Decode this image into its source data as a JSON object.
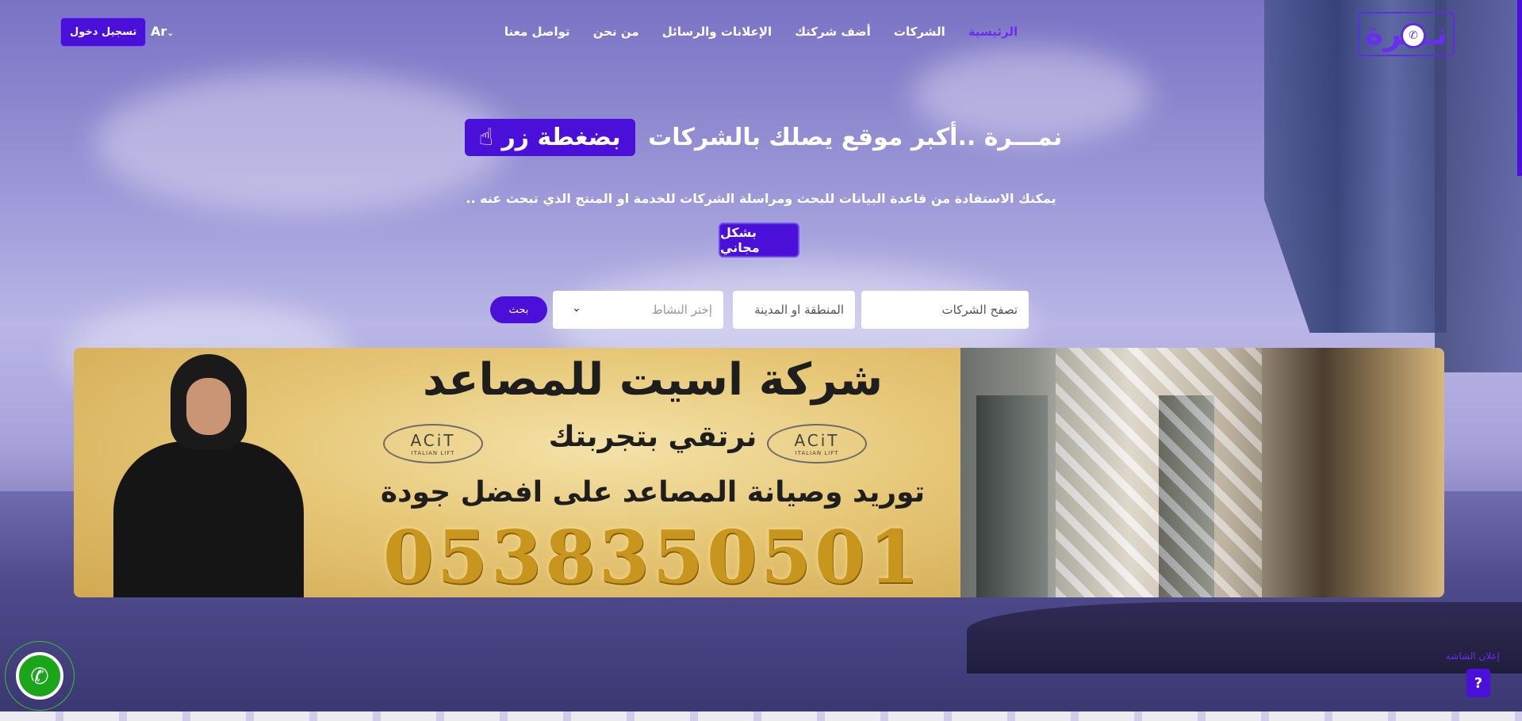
{
  "nav": {
    "logo_text": "نـــرة",
    "items": [
      {
        "label": "الرئيسية",
        "active": true
      },
      {
        "label": "الشركات",
        "active": false
      },
      {
        "label": "أضف شركتك",
        "active": false
      },
      {
        "label": "الإعلانات والرسائل",
        "active": false
      },
      {
        "label": "من نحن",
        "active": false
      },
      {
        "label": "تواصل معنا",
        "active": false
      }
    ],
    "lang": "Ar",
    "login_label": "تسجيل دخول"
  },
  "hero": {
    "title": "نمـــرة ..أكبر موقع يصلك بالشركات",
    "title_pill": "بضغطة زر",
    "subtitle": "يمكنك الاستفادة من قاعدة البيانات للبحث ومراسلة الشركات للخدمة او المنتج الذي تبحث عنه ..",
    "free_label": "بشكل مجاني"
  },
  "search": {
    "companies_placeholder": "تصفح الشركات",
    "region_placeholder": "المنطقة او المدينة",
    "activity_placeholder": "إختر النشاط",
    "button_label": "بحث"
  },
  "banner": {
    "title": "شركة اسيت للمصاعد",
    "tagline": "نرتقي بتجربتك",
    "brand": "ACiT",
    "brand_sub": "ITALIAN LIFT",
    "service": "توريد وصيانة المصاعد على افضل جودة",
    "phone": "0538350501"
  },
  "help": {
    "label": "إعلان الشاشة",
    "icon": "?"
  },
  "colors": {
    "accent": "#4a0fd9",
    "whatsapp": "#1aa51a"
  }
}
